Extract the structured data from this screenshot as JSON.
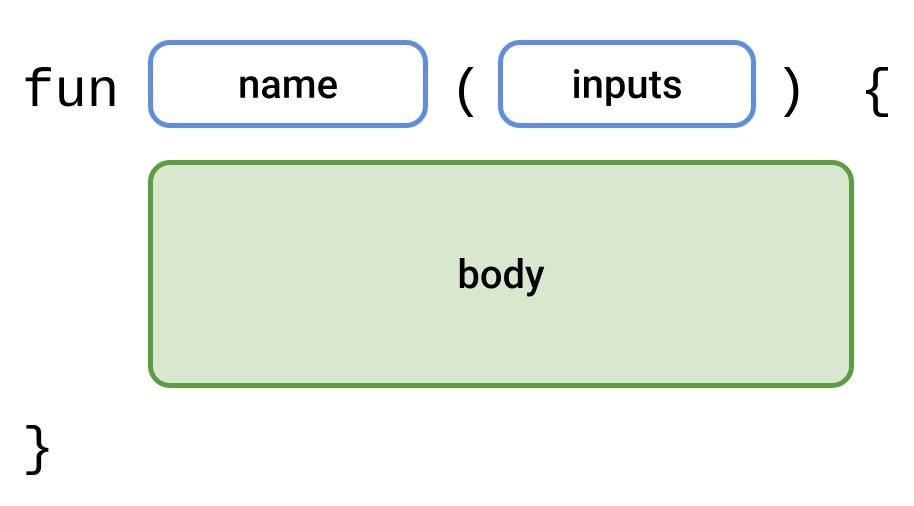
{
  "syntax": {
    "keyword": "fun",
    "open_paren": "(",
    "close_paren": ")",
    "open_brace": "{",
    "close_brace": "}"
  },
  "placeholders": {
    "name": "name",
    "inputs": "inputs",
    "body": "body"
  }
}
